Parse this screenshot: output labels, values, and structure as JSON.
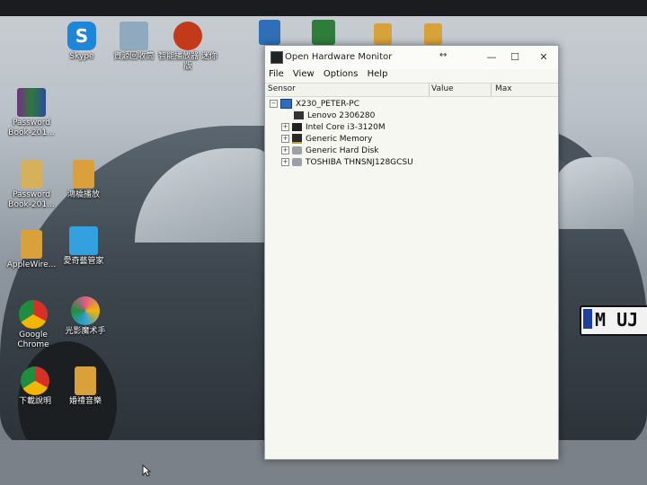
{
  "desktop": {
    "icons": [
      {
        "label": "Skype",
        "color": "#1e86d8"
      },
      {
        "label": "資源回收筒",
        "color": "#6f8ea8"
      },
      {
        "label": "智能播放器 迷你版",
        "color": "#c23a1a"
      },
      {
        "label": "",
        "color": "#2f6fb7"
      },
      {
        "label": "",
        "color": "#2f7d3a"
      },
      {
        "label": "",
        "color": "#d8a13a"
      },
      {
        "label": "",
        "color": "#d8a13a"
      },
      {
        "label": "Password Book-201...",
        "color": "#7a2c8a"
      },
      {
        "label": "Password Book-201...",
        "color": "#d4b15a"
      },
      {
        "label": "鴻橋播放",
        "color": "#d9a03b"
      },
      {
        "label": "AppleWire...",
        "color": "#d8a13a"
      },
      {
        "label": "愛奇藝管家",
        "color": "#33a0e0"
      },
      {
        "label": "Google Chrome",
        "color": "#e1c02a"
      },
      {
        "label": "光影魔术手",
        "color": "#e05a8a"
      },
      {
        "label": "下載說明",
        "color": "#e1c02a"
      },
      {
        "label": "婚禮音樂",
        "color": "#d8a13a"
      }
    ]
  },
  "window": {
    "title": "Open Hardware Monitor",
    "minimize": "—",
    "maximize": "☐",
    "close": "✕",
    "resize_glyph": "↔",
    "menu": [
      "File",
      "View",
      "Options",
      "Help"
    ],
    "columns": {
      "sensor": "Sensor",
      "value": "Value",
      "max": "Max"
    },
    "tree": {
      "root": "X230_PETER-PC",
      "children": [
        {
          "label": "Lenovo 2306280",
          "expandable": false,
          "icon": "motherboard-icon"
        },
        {
          "label": "Intel Core i3-3120M",
          "expandable": true,
          "icon": "cpu-icon"
        },
        {
          "label": "Generic Memory",
          "expandable": true,
          "icon": "memory-icon"
        },
        {
          "label": "Generic Hard Disk",
          "expandable": true,
          "icon": "hdd-icon"
        },
        {
          "label": "TOSHIBA THNSNJ128GCSU",
          "expandable": true,
          "icon": "hdd-icon"
        }
      ]
    }
  },
  "wallpaper": {
    "plate": "M UJ"
  }
}
